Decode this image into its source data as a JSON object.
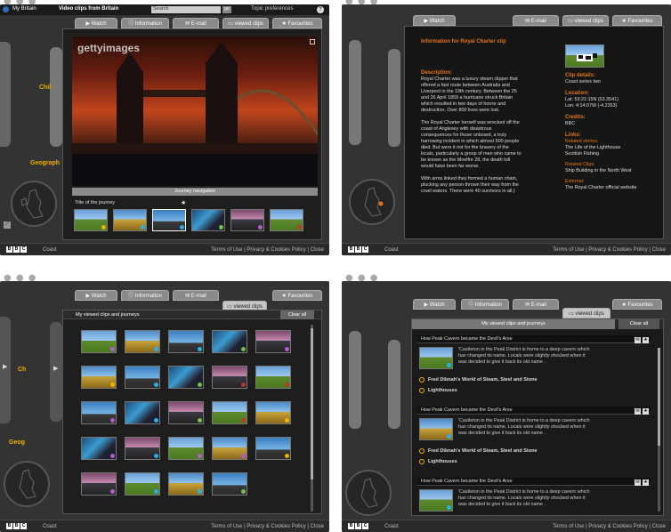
{
  "brand": {
    "bbc": [
      "B",
      "B",
      "C"
    ],
    "program": "Coast",
    "footer_links": "Terms of Use | Privacy & Cookies Policy | Close"
  },
  "window_dots": "● ● ●",
  "tabs": {
    "watch": "Watch",
    "information": "Information",
    "email": "E-mail",
    "viewed_clips": "viewed clips",
    "favourites": "Favourites"
  },
  "w1": {
    "topbar": {
      "title": "My Britain",
      "subtitle": "Video clips from Britain",
      "search": "Search",
      "go": "go",
      "prefs": "Topic preferences",
      "help": "?"
    },
    "watermark": "gettyimages",
    "nav_label": "Journey navigation",
    "journey_title": "Title of the journey",
    "side_labels": [
      "Chil",
      "Geograph"
    ],
    "thumbs": [
      {
        "dot": "#f0b000"
      },
      {
        "dot": "#2ab0e8"
      },
      {
        "dot": "#2ab0e8"
      },
      {
        "dot": "#76c043"
      },
      {
        "dot": "#b35ec7"
      },
      {
        "dot": "#c0392b"
      }
    ]
  },
  "w2": {
    "header": "Information for Royal Charter clip",
    "desc_h": "Description:",
    "desc": [
      "Royal Charter was a luxury steam clipper that",
      "offered a fast route between Australia and",
      "Liverpool in the 19th century. Between the 25",
      "and 26 April 1859 a hurricane struck Britain",
      "which resulted in two days of horror and",
      "destruction. Over 800 lives were lost.",
      "",
      "The Royal Charter herself was wrecked off the",
      "coast of Anglesey with disastrous",
      "consequences for those onboard, a truly",
      "harrowing incident in which almost 500 people",
      "died. But were it not for the bravery of the",
      "locals, particularly a group of men who came to",
      "be known as the Moelfre 28, the death toll",
      "would have been far worse.",
      "",
      "With arms linked they formed a human chain,",
      "plucking any person thrown their way from the",
      "cruel waters. There were 40 survivors in all.)"
    ],
    "clip_details_h": "Clip details:",
    "clip_details": "Coast series two",
    "location_h": "Location:",
    "lat": "Lat: 53:21:15N (53.3541)",
    "lon": "Lon: 4:14:07W (-4.2353)",
    "credits_h": "Credits:",
    "credits": "BBC",
    "links_h": "Links:",
    "related_stories_h": "Related stories:",
    "related_stories": [
      "The Life of the Lighthouse",
      "Scottish Fishing"
    ],
    "related_clips_h": "Related Clips:",
    "related_clips": "Ship Building in the North West",
    "external_h": "External:",
    "external": "The Royal Charter official website"
  },
  "w3": {
    "header": "My viewed clips and journeys",
    "clear": "Clear all",
    "side_labels": [
      "Ch",
      "Geog"
    ],
    "rows": [
      [
        "#b35ec7",
        "#2ab0e8",
        "#2ab0e8",
        "#76c043",
        "#b35ec7"
      ],
      [
        "#f0b000",
        "#2ab0e8",
        "#76c043",
        "#c0392b",
        "#c0392b"
      ],
      [
        "#b35ec7",
        "#2ab0e8",
        "#76c043",
        "#c0392b",
        "#f0b000"
      ],
      [
        "#b35ec7",
        "#2ab0e8",
        "#b35ec7",
        "#b35ec7",
        "#f0b000"
      ],
      [
        "#b35ec7",
        "#2ab0e8",
        "#2ab0e8",
        "#76c043"
      ]
    ]
  },
  "w4": {
    "header": "My viewed clips and journeys",
    "clear": "Clear all",
    "items": [
      {
        "title": "How Peak Cavern became the Devil's Arse",
        "desc": [
          "'Castleton in the Peak District is home to a deep cavern which",
          "has changed its name. Locals were slightly shocked when it",
          "was decided to give it back its old name ."
        ],
        "links": [
          "Fred Dibnah's World of Steam, Steel and Stone",
          "Lighthouses"
        ]
      },
      {
        "title": "How Peak Cavern became the Devil's Arse",
        "desc": [
          "'Castleton in the Peak District is home to a deep cavern which",
          "has changed its name. Locals were slightly shocked when it",
          "was decided to give it back its old name ."
        ],
        "links": [
          "Fred Dibnah's World of Steam, Steel and Stone",
          "Lighthouses"
        ]
      },
      {
        "title": "How Peak Cavern became the Devil's Arse",
        "desc": [
          "'Castleton in the Peak District is home to a deep cavern which",
          "has changed its name. Locals were slightly shocked when it",
          "was decided to give it back its old name ."
        ],
        "links": []
      }
    ]
  }
}
